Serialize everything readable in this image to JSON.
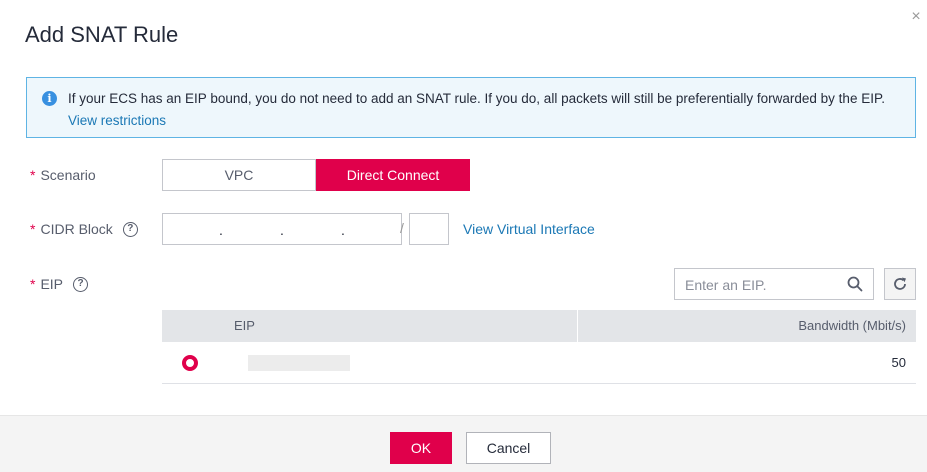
{
  "dialog": {
    "title": "Add SNAT Rule",
    "close_glyph": "×"
  },
  "alert": {
    "icon": "info-icon",
    "text": "If your ECS has an EIP bound, you do not need to add an SNAT rule. If you do, all packets will still be preferentially forwarded by the EIP.",
    "link": "View restrictions"
  },
  "form": {
    "required_mark": "*",
    "scenario": {
      "label": "Scenario",
      "options": [
        "VPC",
        "Direct Connect"
      ],
      "selected": "Direct Connect"
    },
    "cidr": {
      "label": "CIDR Block",
      "separator": ".",
      "slash": "/",
      "link": "View Virtual Interface"
    },
    "eip": {
      "label": "EIP",
      "search_placeholder": "Enter an EIP.",
      "columns": [
        "EIP",
        "Bandwidth (Mbit/s)"
      ],
      "rows": [
        {
          "eip": "",
          "bandwidth": "50",
          "selected": true
        }
      ]
    },
    "help_glyph": "?"
  },
  "footer": {
    "ok": "OK",
    "cancel": "Cancel"
  },
  "colors": {
    "accent": "#e0004b",
    "link": "#1b78b5",
    "alert_border": "#5fb4e4",
    "alert_bg": "#eef7fc"
  }
}
